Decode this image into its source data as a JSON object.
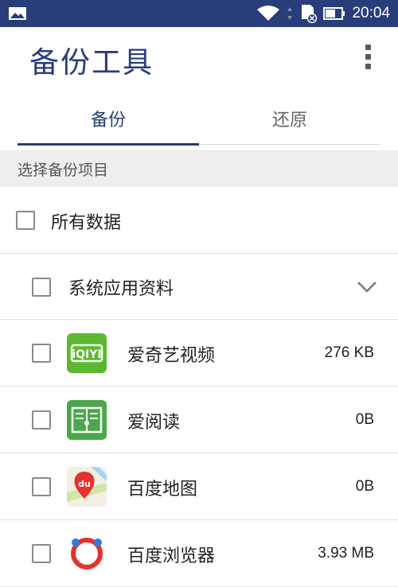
{
  "status_bar": {
    "time": "20:04",
    "icons": [
      "gallery-icon",
      "wifi-icon",
      "sd-card-icon",
      "battery-icon"
    ]
  },
  "header": {
    "title": "备份工具",
    "menu_icon": "more-vert-icon"
  },
  "tabs": [
    {
      "label": "备份",
      "selected": true
    },
    {
      "label": "还原",
      "selected": false
    }
  ],
  "section": {
    "label": "选择备份项目"
  },
  "all_data": {
    "label": "所有数据",
    "checked": false
  },
  "system_group": {
    "label": "系统应用资料",
    "checked": false,
    "expand_icon": "chevron-down-icon"
  },
  "apps": [
    {
      "name": "爱奇艺视频",
      "size": "276 KB",
      "icon": "iqiyi-icon",
      "checked": false
    },
    {
      "name": "爱阅读",
      "size": "0B",
      "icon": "ireader-icon",
      "checked": false
    },
    {
      "name": "百度地图",
      "size": "0B",
      "icon": "baidu-map-icon",
      "checked": false
    },
    {
      "name": "百度浏览器",
      "size": "3.93 MB",
      "icon": "baidu-browser-icon",
      "checked": false
    }
  ],
  "colors": {
    "primary": "#283d7a",
    "section_bg": "#eeeeee",
    "iqiyi_green": "#5cb82e",
    "ireader_green": "#4aa84a"
  }
}
